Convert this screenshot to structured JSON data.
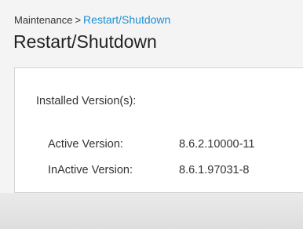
{
  "breadcrumb": {
    "parent": "Maintenance",
    "separator": ">",
    "current": "Restart/Shutdown"
  },
  "page_title": "Restart/Shutdown",
  "panel": {
    "section_label": "Installed Version(s):",
    "rows": [
      {
        "label": "Active Version:",
        "value": "8.6.2.10000-11"
      },
      {
        "label": "InActive Version:",
        "value": "8.6.1.97031-8"
      }
    ]
  }
}
